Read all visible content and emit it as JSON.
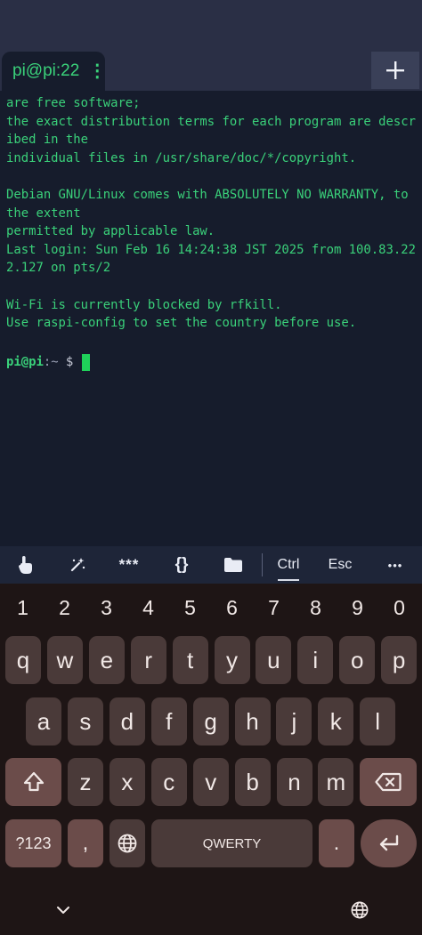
{
  "tab": {
    "title": "pi@pi:22",
    "menu_glyph": "⋮"
  },
  "terminal": {
    "lines": [
      "are free software;",
      "the exact distribution terms for each program are descr",
      "ibed in the",
      "individual files in /usr/share/doc/*/copyright.",
      "",
      "Debian GNU/Linux comes with ABSOLUTELY NO WARRANTY, to",
      "the extent",
      "permitted by applicable law.",
      "Last login: Sun Feb 16 14:24:38 JST 2025 from 100.83.22",
      "2.127 on pts/2",
      "",
      "Wi-Fi is currently blocked by rfkill.",
      "Use raspi-config to set the country before use.",
      ""
    ],
    "prompt": {
      "user": "pi@pi",
      "path": ":~",
      "sign": " $ "
    }
  },
  "extra_keys": {
    "touch_icon": "touch-hand-icon",
    "magic_icon": "magic-wand-icon",
    "stars": "***",
    "braces": "{}",
    "folder_icon": "folder-icon",
    "ctrl": "Ctrl",
    "esc": "Esc",
    "more": "•••"
  },
  "keyboard": {
    "numbers": [
      "1",
      "2",
      "3",
      "4",
      "5",
      "6",
      "7",
      "8",
      "9",
      "0"
    ],
    "row1": [
      "q",
      "w",
      "e",
      "r",
      "t",
      "y",
      "u",
      "i",
      "o",
      "p"
    ],
    "row2": [
      "a",
      "s",
      "d",
      "f",
      "g",
      "h",
      "j",
      "k",
      "l"
    ],
    "row3": [
      "z",
      "x",
      "c",
      "v",
      "b",
      "n",
      "m"
    ],
    "mode": "?123",
    "comma": ",",
    "space": "QWERTY",
    "period": "."
  },
  "colors": {
    "terminal_text": "#3ad17a",
    "terminal_bg": "#161c2c",
    "keyboard_bg": "#1e1515",
    "key_bg": "#4a3a39",
    "special_key_bg": "#6b4c4a"
  }
}
